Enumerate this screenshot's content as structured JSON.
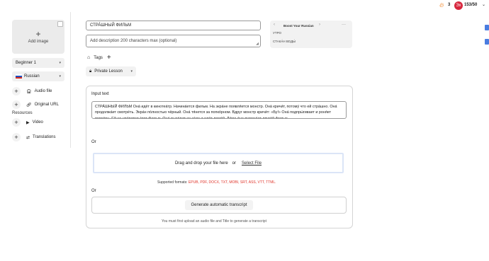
{
  "header": {
    "streak_icon": "fire-icon",
    "streak_count": "3",
    "coins": "153/50",
    "avatar_icon": "avatar-badge"
  },
  "sidebar": {
    "add_image": {
      "label": "Add image",
      "icon": "plus-icon"
    },
    "level": {
      "value": "Beginner 1"
    },
    "language": {
      "value": "Russian",
      "flag": "russia-flag-icon"
    },
    "audio": {
      "label": "Audio file"
    },
    "original_url": {
      "label": "Original URL"
    },
    "resources_label": "Resources",
    "video": {
      "label": "Video"
    },
    "translations": {
      "label": "Translations"
    }
  },
  "form": {
    "title_value": "СТРА́ШНЫЙ ФИЛЬМ",
    "description_placeholder": "Add description 200 characters max (optional)",
    "tags_label": "Tags",
    "privacy_value": "Private Lesson"
  },
  "collection_card": {
    "title": "Boost Your Russian",
    "items": [
      "УТРО",
      "СТАКА́Н ВОДЫ́"
    ]
  },
  "input": {
    "label": "Input text",
    "text": "СТРА́ШНЫЙ ФИЛЬМ Она́ идёт в кинотеа́тр. Начина́ется фильм. На экра́не появля́ется монстр. Она́ кричи́т, потому́ что ей стра́шно. Она́ продолжа́ет смотре́ть. Экра́н по́лностью чёрный. Она́ тя́нется за попко́рном. Вдруг монстр кричи́т: «Бу!» Она́ подпры́гивает и роня́ет попко́рн. Ей не нра́вится э́тот фильм. Она́ выхо́дит из за́ла и идёт домо́й. До́ма о́на включа́ет друго́й фильм.",
    "or_1": "Or",
    "drop_text": "Drag and drop your file here",
    "drop_or": "or",
    "select_file": "Select File",
    "formats_label": "Supported formats:",
    "formats": "EPUB, PDF, DOCX, TXT, MOBI, SRT, ASS, VTT, TTML.",
    "or_2": "Or",
    "generate_label": "Generate automatic transcript",
    "generate_note": "You must first upload an audio file and Title to generate a transcript"
  },
  "colors": {
    "accent_red": "#d7263d",
    "formats_red": "#e0352b",
    "fire": "#f07d18"
  }
}
